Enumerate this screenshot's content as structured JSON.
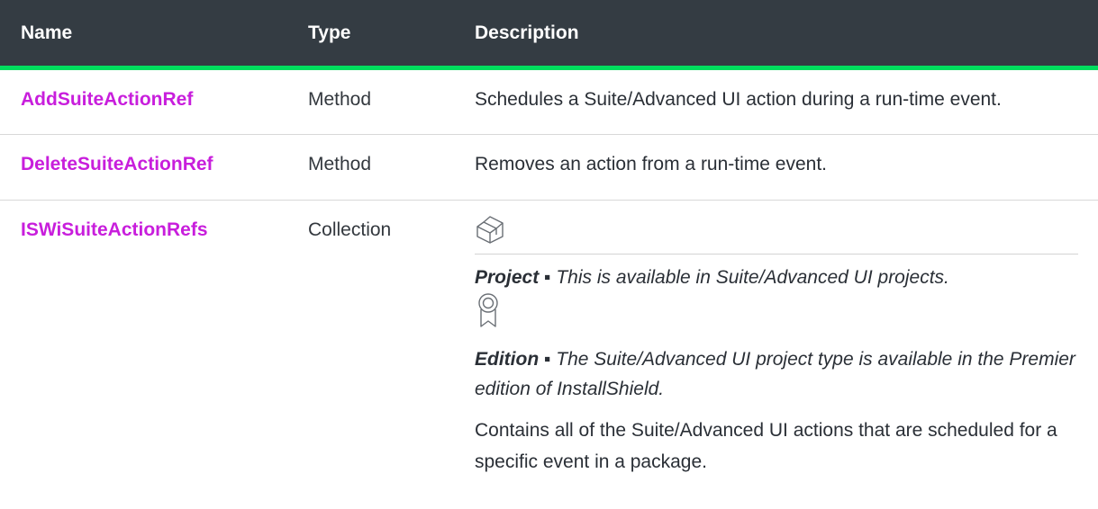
{
  "table": {
    "headers": {
      "name": "Name",
      "type": "Type",
      "description": "Description"
    },
    "rows": [
      {
        "name": "AddSuiteActionRef",
        "type": "Method",
        "description": "Schedules a Suite/Advanced UI action during a run-time event."
      },
      {
        "name": "DeleteSuiteActionRef",
        "type": "Method",
        "description": "Removes an action from a run-time event."
      },
      {
        "name": "ISWiSuiteActionRefs",
        "type": "Collection",
        "project_icon": "box-icon",
        "project_label": "Project ▪",
        "project_text": "This is available in Suite/Advanced UI projects.",
        "edition_icon": "award-ribbon-icon",
        "edition_label": "Edition ▪",
        "edition_text": "The Suite/Advanced UI project type is available in the Premier edition of InstallShield.",
        "description": "Contains all of the Suite/Advanced UI actions that are scheduled for a specific event in a package."
      }
    ]
  },
  "colors": {
    "header_bg": "#343c43",
    "accent_green": "#00de5e",
    "link": "#c81edc"
  }
}
